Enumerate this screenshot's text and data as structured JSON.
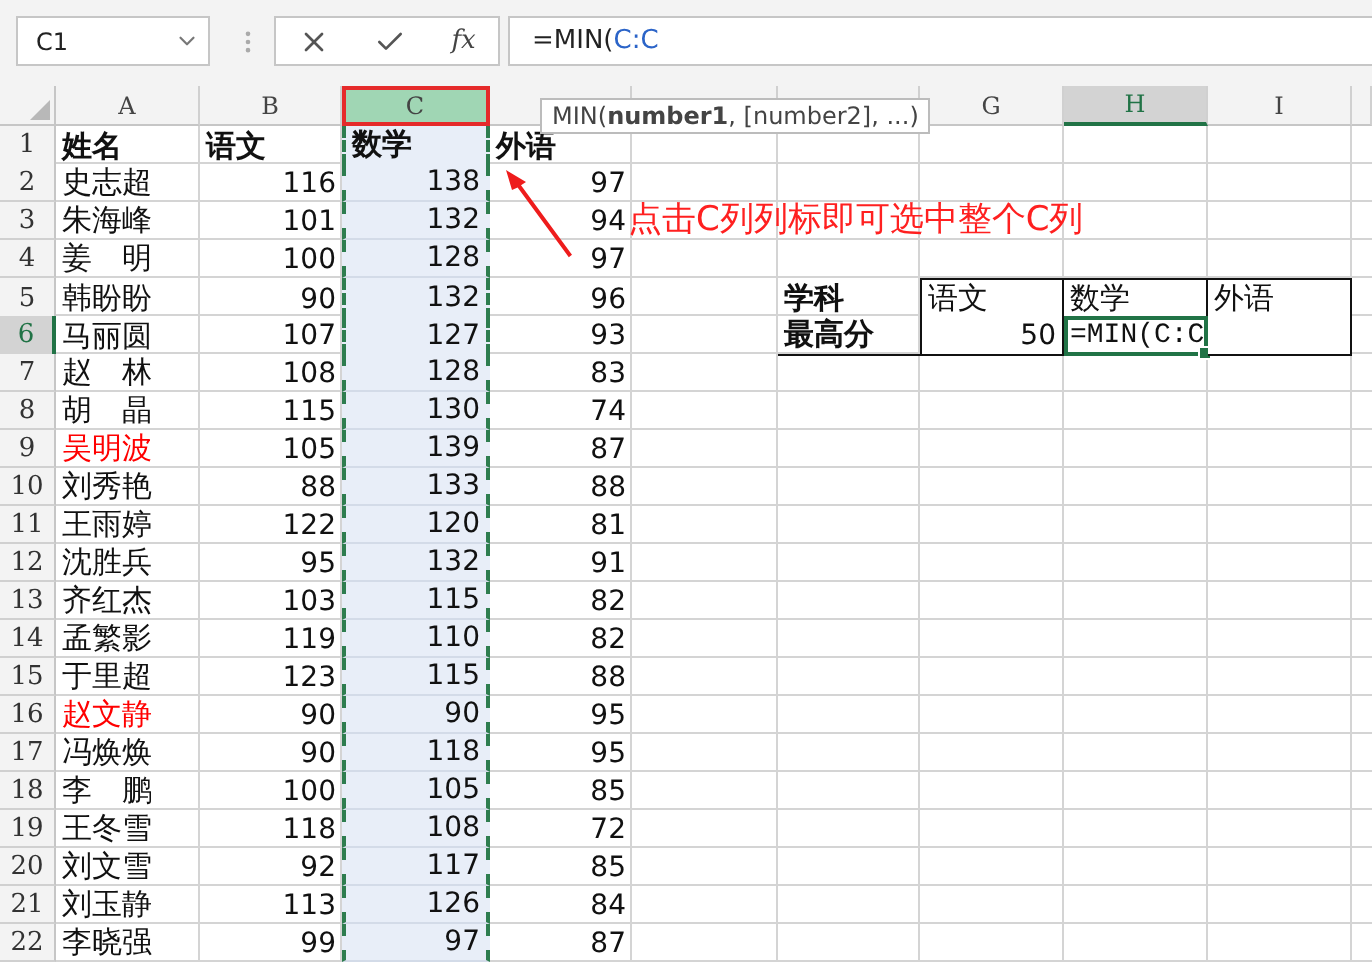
{
  "name_box": {
    "value": "C1"
  },
  "formula_bar": {
    "function_label": "fx",
    "prefix": "=MIN(",
    "reference": "C:C"
  },
  "formula_tooltip": "MIN(**number1**, [number2], ...)",
  "columns": [
    {
      "label": "A",
      "selected": false,
      "active": false
    },
    {
      "label": "B",
      "selected": false,
      "active": false
    },
    {
      "label": "C",
      "selected": true,
      "active": false
    },
    {
      "selected": false,
      "active": false
    },
    {
      "selected": false,
      "active": false
    },
    {
      "selected": false,
      "active": false
    },
    {
      "label": "G",
      "selected": false,
      "active": false
    },
    {
      "label": "H",
      "selected": false,
      "active": true
    },
    {
      "label": "I",
      "selected": false,
      "active": false
    }
  ],
  "row_numbers": [
    {
      "label": "1",
      "active": false
    },
    {
      "label": "2",
      "active": false
    },
    {
      "label": "3",
      "active": false
    },
    {
      "label": "4",
      "active": false
    },
    {
      "label": "5",
      "active": false
    },
    {
      "label": "6",
      "active": true
    },
    {
      "label": "7",
      "active": false
    },
    {
      "label": "8",
      "active": false
    },
    {
      "label": "9",
      "active": false
    },
    {
      "label": "10",
      "active": false
    },
    {
      "label": "11",
      "active": false
    },
    {
      "label": "12",
      "active": false
    },
    {
      "label": "13",
      "active": false
    },
    {
      "label": "14",
      "active": false
    },
    {
      "label": "15",
      "active": false
    },
    {
      "label": "16",
      "active": false
    },
    {
      "label": "17",
      "active": false
    },
    {
      "label": "18",
      "active": false
    },
    {
      "label": "19",
      "active": false
    },
    {
      "label": "20",
      "active": false
    },
    {
      "label": "21",
      "active": false
    },
    {
      "label": "22",
      "active": false
    }
  ],
  "students": {
    "header": [
      "姓名",
      "语文",
      "数学",
      "外语"
    ],
    "rows": [
      {
        "name": "史志超",
        "highlight": false,
        "chinese": "116",
        "math": "138",
        "english": "97"
      },
      {
        "name": "朱海峰",
        "highlight": false,
        "chinese": "101",
        "math": "132",
        "english": "94"
      },
      {
        "name": "姜　明",
        "highlight": false,
        "chinese": "100",
        "math": "128",
        "english": "97"
      },
      {
        "name": "韩盼盼",
        "highlight": false,
        "chinese": "90",
        "math": "132",
        "english": "96"
      },
      {
        "name": "马丽圆",
        "highlight": false,
        "chinese": "107",
        "math": "127",
        "english": "93"
      },
      {
        "name": "赵　林",
        "highlight": false,
        "chinese": "108",
        "math": "128",
        "english": "83"
      },
      {
        "name": "胡　晶",
        "highlight": false,
        "chinese": "115",
        "math": "130",
        "english": "74"
      },
      {
        "name": "吴明波",
        "highlight": true,
        "chinese": "105",
        "math": "139",
        "english": "87"
      },
      {
        "name": "刘秀艳",
        "highlight": false,
        "chinese": "88",
        "math": "133",
        "english": "88"
      },
      {
        "name": "王雨婷",
        "highlight": false,
        "chinese": "122",
        "math": "120",
        "english": "81"
      },
      {
        "name": "沈胜兵",
        "highlight": false,
        "chinese": "95",
        "math": "132",
        "english": "91"
      },
      {
        "name": "齐红杰",
        "highlight": false,
        "chinese": "103",
        "math": "115",
        "english": "82"
      },
      {
        "name": "孟繁影",
        "highlight": false,
        "chinese": "119",
        "math": "110",
        "english": "82"
      },
      {
        "name": "于里超",
        "highlight": false,
        "chinese": "123",
        "math": "115",
        "english": "88"
      },
      {
        "name": "赵文静",
        "highlight": true,
        "chinese": "90",
        "math": "90",
        "english": "95"
      },
      {
        "name": "冯焕焕",
        "highlight": false,
        "chinese": "90",
        "math": "118",
        "english": "95"
      },
      {
        "name": "李　鹏",
        "highlight": false,
        "chinese": "100",
        "math": "105",
        "english": "85"
      },
      {
        "name": "王冬雪",
        "highlight": false,
        "chinese": "118",
        "math": "108",
        "english": "72"
      },
      {
        "name": "刘文雪",
        "highlight": false,
        "chinese": "92",
        "math": "117",
        "english": "85"
      },
      {
        "name": "刘玉静",
        "highlight": false,
        "chinese": "113",
        "math": "126",
        "english": "84"
      },
      {
        "name": "李晓强",
        "highlight": false,
        "chinese": "99",
        "math": "97",
        "english": "87"
      }
    ]
  },
  "summary": {
    "header_label": "学科",
    "subjects": [
      "语文",
      "数学",
      "外语"
    ],
    "row_label": "最高分",
    "values": [
      {
        "text": "50",
        "active": false
      },
      {
        "text": "=MIN(C:C",
        "active": true
      }
    ]
  },
  "annotation": {
    "text": "点击C列列标即可选中整个C列"
  }
}
